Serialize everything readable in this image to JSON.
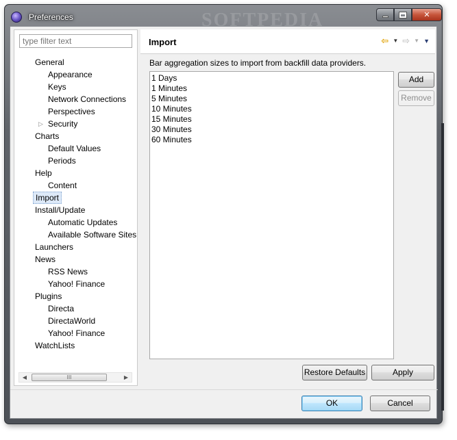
{
  "window": {
    "title": "Preferences",
    "watermark": "SOFTPEDIA",
    "buttons": {
      "minimize": "minimize",
      "maximize": "maximize",
      "close": "✕"
    }
  },
  "filter": {
    "placeholder": "type filter text"
  },
  "tree": {
    "items": [
      {
        "label": "General",
        "level": 0
      },
      {
        "label": "Appearance",
        "level": 1
      },
      {
        "label": "Keys",
        "level": 1
      },
      {
        "label": "Network Connections",
        "level": 1
      },
      {
        "label": "Perspectives",
        "level": 1
      },
      {
        "label": "Security",
        "level": 1,
        "expandable": true
      },
      {
        "label": "Charts",
        "level": 0
      },
      {
        "label": "Default Values",
        "level": 1
      },
      {
        "label": "Periods",
        "level": 1
      },
      {
        "label": "Help",
        "level": 0
      },
      {
        "label": "Content",
        "level": 1
      },
      {
        "label": "Import",
        "level": 0,
        "selected": true
      },
      {
        "label": "Install/Update",
        "level": 0
      },
      {
        "label": "Automatic Updates",
        "level": 1
      },
      {
        "label": "Available Software Sites",
        "level": 1
      },
      {
        "label": "Launchers",
        "level": 0
      },
      {
        "label": "News",
        "level": 0
      },
      {
        "label": "RSS News",
        "level": 1
      },
      {
        "label": "Yahoo! Finance",
        "level": 1
      },
      {
        "label": "Plugins",
        "level": 0
      },
      {
        "label": "Directa",
        "level": 1
      },
      {
        "label": "DirectaWorld",
        "level": 1
      },
      {
        "label": "Yahoo! Finance",
        "level": 1
      },
      {
        "label": "WatchLists",
        "level": 0
      }
    ],
    "scroll_thumb_label": "III"
  },
  "page": {
    "title": "Import",
    "description": "Bar aggregation sizes to import from backfill data providers.",
    "sizes": [
      "1 Days",
      "1 Minutes",
      "5 Minutes",
      "10 Minutes",
      "15 Minutes",
      "30 Minutes",
      "60 Minutes"
    ],
    "add_label": "Add",
    "remove_label": "Remove",
    "restore_defaults_label": "Restore Defaults",
    "apply_label": "Apply"
  },
  "footer": {
    "ok_label": "OK",
    "cancel_label": "Cancel"
  },
  "colors": {
    "selection": "#dde9f8",
    "back_arrow": "#e0a000",
    "default_button": "#bee6fd"
  }
}
